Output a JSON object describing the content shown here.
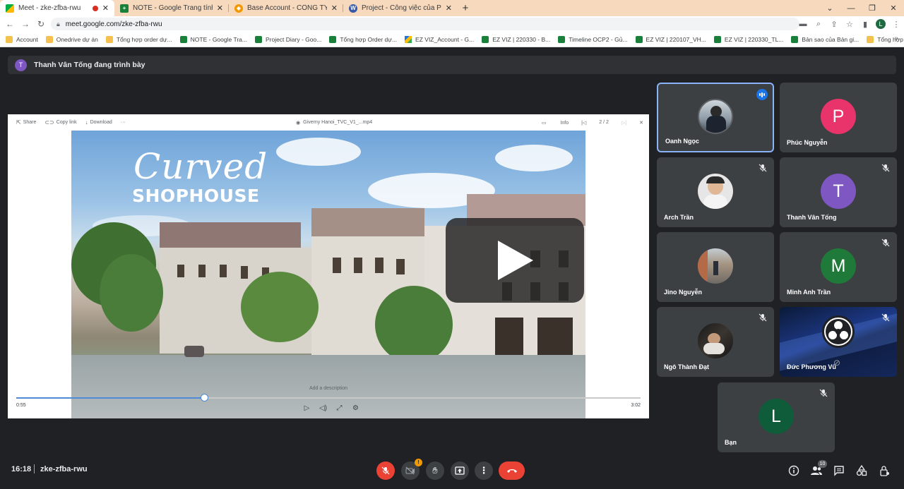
{
  "browser": {
    "tabs": [
      {
        "title": "Meet - zke-zfba-rwu",
        "favicon": "meet-icon",
        "active": true,
        "recording": true
      },
      {
        "title": "NOTE - Google Trang tính",
        "favicon": "sheets-icon",
        "active": false
      },
      {
        "title": "Base Account - CÔNG TY TNHH",
        "favicon": "base-icon",
        "active": false
      },
      {
        "title": "Project - Công việc của Phương",
        "favicon": "wordpress-icon",
        "active": false
      }
    ],
    "url": "meet.google.com/zke-zfba-rwu",
    "profile_initial": "L",
    "bookmarks": [
      {
        "label": "Account",
        "icon": "folder"
      },
      {
        "label": "Onedrive dự án",
        "icon": "folder"
      },
      {
        "label": "Tổng hợp order dự...",
        "icon": "folder"
      },
      {
        "label": "NOTE - Google Tra...",
        "icon": "sheet"
      },
      {
        "label": "Project Diary - Goo...",
        "icon": "sheet"
      },
      {
        "label": "Tổng hợp Order dự...",
        "icon": "sheet"
      },
      {
        "label": "EZ VIZ_Account - G...",
        "icon": "drive"
      },
      {
        "label": "EZ VIZ | 220330 - B...",
        "icon": "sheet"
      },
      {
        "label": "Timeline OCP2 - Gủ...",
        "icon": "sheet"
      },
      {
        "label": "EZ VIZ | 220107_VH...",
        "icon": "sheet"
      },
      {
        "label": "EZ VIZ | 220330_TL...",
        "icon": "sheet"
      },
      {
        "label": "Bản sao của Bản gi...",
        "icon": "sheet"
      },
      {
        "label": "Tổng hợp ord OCP2",
        "icon": "folder"
      }
    ]
  },
  "meet": {
    "presenter_initial": "T",
    "presenting_text": "Thanh Vân Tống đang trình bày",
    "viewer": {
      "share_label": "Share",
      "copy_link_label": "Copy link",
      "download_label": "Download",
      "more_label": "···",
      "file_name": "Giverny Hanoi_TVC_V1_...mp4",
      "info_label": "Info",
      "page_counter": "2 / 2",
      "description_placeholder": "Add a description",
      "current_time": "0:55",
      "total_time": "3:02",
      "progress": 0.302
    },
    "video_text": {
      "script_title": "Curved",
      "block_title": "SHOPHOUSE"
    },
    "participants": [
      {
        "name": "Oanh Ngọc",
        "type": "photo",
        "speaking": true,
        "muted": false
      },
      {
        "name": "Phúc Nguyễn",
        "initial": "P",
        "color": "#e8336b",
        "muted": false
      },
      {
        "name": "Arch Trần",
        "type": "photo",
        "muted": true
      },
      {
        "name": "Thanh Vân Tống",
        "initial": "T",
        "color": "#7e57c2",
        "muted": true
      },
      {
        "name": "Jino Nguyễn",
        "type": "photo",
        "muted": false
      },
      {
        "name": "Minh Anh Trần",
        "initial": "M",
        "color": "#1f7a3a",
        "muted": true
      },
      {
        "name": "Ngô Thành Đạt",
        "type": "photo",
        "muted": true
      },
      {
        "name": "Đức Phương Vũ",
        "type": "obs",
        "muted": true
      },
      {
        "name": "Bạn",
        "initial": "L",
        "color": "#0f5c3a",
        "muted": true
      }
    ],
    "bottom": {
      "time": "16:18",
      "meeting_code": "zke-zfba-rwu",
      "camera_badge": "!",
      "participant_count": "10"
    }
  }
}
